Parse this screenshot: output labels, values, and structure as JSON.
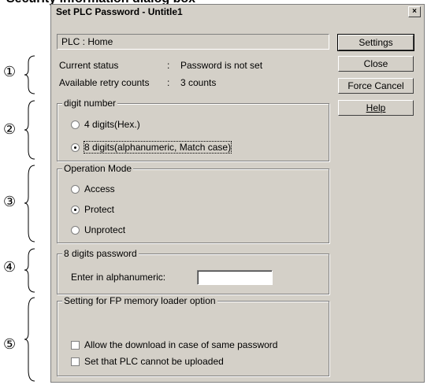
{
  "page_heading": "Security information dialog box",
  "dialog": {
    "title": "Set PLC Password - Untitle1",
    "close_glyph": "×",
    "plc_info": "PLC  :  Home",
    "status": {
      "current_label": "Current status",
      "current_sep": ":",
      "current_value": "Password is not set",
      "retry_label": "Available retry counts",
      "retry_sep": ":",
      "retry_value": "3 counts"
    },
    "digit_group": {
      "label": "digit number",
      "options": [
        "4 digits(Hex.)",
        "8 digits(alphanumeric, Match case)"
      ],
      "selected": "8 digits(alphanumeric, Match case)"
    },
    "mode_group": {
      "label": "Operation Mode",
      "options": [
        "Access",
        "Protect",
        "Unprotect"
      ],
      "selected": "Protect"
    },
    "password_group": {
      "label": "8 digits password",
      "field_label": "Enter in alphanumeric:",
      "field_value": ""
    },
    "fp_group": {
      "label": "Setting for FP memory loader option",
      "checks": [
        {
          "label": "Allow the download in case of same password",
          "checked": false
        },
        {
          "label": "Set that PLC cannot be uploaded",
          "checked": false
        }
      ]
    },
    "buttons": {
      "settings": "Settings",
      "close": "Close",
      "force_cancel": "Force Cancel",
      "help": "Help"
    }
  },
  "markers": [
    "①",
    "②",
    "③",
    "④",
    "⑤"
  ]
}
